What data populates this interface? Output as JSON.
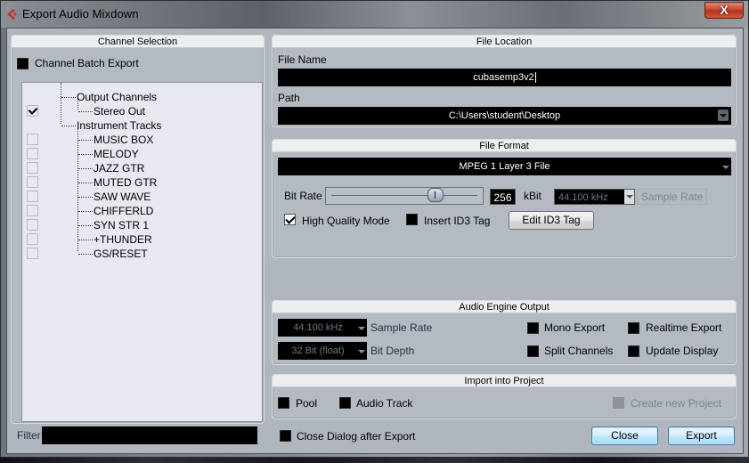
{
  "window": {
    "title": "Export Audio Mixdown",
    "icon": "cubase-logo-icon",
    "close_label": "X"
  },
  "channel_selection": {
    "header": "Channel Selection",
    "batch_export_label": "Channel Batch Export",
    "batch_export_checked": false,
    "tree": [
      {
        "label": "Output Channels",
        "level": 0,
        "has_checkbox": false
      },
      {
        "label": "Stereo Out",
        "level": 1,
        "has_checkbox": true,
        "checked": true
      },
      {
        "label": "Instrument Tracks",
        "level": 0,
        "has_checkbox": false
      },
      {
        "label": "MUSIC BOX",
        "level": 1,
        "has_checkbox": true,
        "checked": false
      },
      {
        "label": "MELODY",
        "level": 1,
        "has_checkbox": true,
        "checked": false
      },
      {
        "label": "JAZZ GTR",
        "level": 1,
        "has_checkbox": true,
        "checked": false
      },
      {
        "label": "MUTED GTR",
        "level": 1,
        "has_checkbox": true,
        "checked": false
      },
      {
        "label": "SAW WAVE",
        "level": 1,
        "has_checkbox": true,
        "checked": false
      },
      {
        "label": "CHIFFERLD",
        "level": 1,
        "has_checkbox": true,
        "checked": false
      },
      {
        "label": "SYN STR 1",
        "level": 1,
        "has_checkbox": true,
        "checked": false
      },
      {
        "label": "+THUNDER",
        "level": 1,
        "has_checkbox": true,
        "checked": false
      },
      {
        "label": "GS/RESET",
        "level": 1,
        "has_checkbox": true,
        "checked": false
      }
    ],
    "filter_label": "Filter",
    "filter_value": ""
  },
  "file_location": {
    "header": "File Location",
    "file_name_label": "File Name",
    "file_name_value": "cubasemp3v2",
    "path_label": "Path",
    "path_value": "C:\\Users\\student\\Desktop"
  },
  "file_format": {
    "header": "File Format",
    "format_value": "MPEG 1 Layer 3 File",
    "bit_rate_label": "Bit Rate",
    "bit_rate_value": "256",
    "bit_rate_slider_fraction": 0.72,
    "bit_rate_unit": "kBit",
    "sample_rate_value": "44.100 kHz",
    "sample_rate_label": "Sample Rate",
    "high_quality_label": "High Quality Mode",
    "high_quality_checked": true,
    "insert_id3_label": "Insert ID3 Tag",
    "insert_id3_checked": false,
    "edit_id3_button": "Edit ID3 Tag"
  },
  "audio_engine": {
    "header": "Audio Engine Output",
    "sample_rate_value": "44.100 kHz",
    "sample_rate_label": "Sample Rate",
    "bit_depth_value": "32 Bit (float)",
    "bit_depth_label": "Bit Depth",
    "mono_export_label": "Mono Export",
    "split_channels_label": "Split Channels",
    "realtime_export_label": "Realtime Export",
    "update_display_label": "Update Display"
  },
  "import_project": {
    "header": "Import into Project",
    "pool_label": "Pool",
    "audio_track_label": "Audio Track",
    "create_project_label": "Create new Project"
  },
  "footer": {
    "close_after_label": "Close Dialog after Export",
    "close_button": "Close",
    "export_button": "Export"
  }
}
